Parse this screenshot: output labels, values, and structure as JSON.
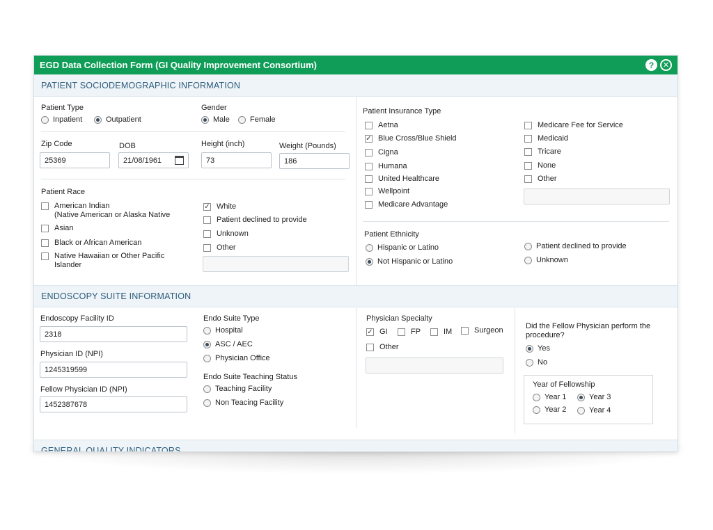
{
  "window": {
    "title": "EGD Data Collection Form (GI Quality Improvement Consortium)",
    "help_glyph": "?",
    "close_glyph": "✕"
  },
  "sections": {
    "patient": "PATIENT SOCIODEMOGRAPHIC INFORMATION",
    "endoscopy": "ENDOSCOPY SUITE INFORMATION",
    "quality": "GENERAL QUALITY INDICATORS"
  },
  "patient_type": {
    "label": "Patient Type",
    "options": [
      "Inpatient",
      "Outpatient"
    ],
    "selected": "Outpatient"
  },
  "gender": {
    "label": "Gender",
    "options": [
      "Male",
      "Female"
    ],
    "selected": "Male"
  },
  "zip": {
    "label": "Zip Code",
    "value": "25369"
  },
  "dob": {
    "label": "DOB",
    "value": "21/08/1961"
  },
  "height": {
    "label": "Height (inch)",
    "value": "73"
  },
  "weight": {
    "label": "Weight (Pounds)",
    "value": "186"
  },
  "race": {
    "label": "Patient Race",
    "american_indian": "American Indian",
    "american_indian_sub": "(Native American or Alaska Native",
    "asian": "Asian",
    "black": "Black or African American",
    "hawaiian_1": "Native Hawaiian or Other Pacific",
    "hawaiian_2": "Islander",
    "white": "White",
    "declined": "Patient declined to provide",
    "unknown": "Unknown",
    "other": "Other",
    "checked": [
      "White"
    ]
  },
  "insurance": {
    "label": "Patient Insurance Type",
    "col1": [
      "Aetna",
      "Blue Cross/Blue Shield",
      "Cigna",
      "Humana",
      "United Healthcare",
      "Wellpoint",
      "Medicare Advantage"
    ],
    "col2": [
      "Medicare Fee for Service",
      "Medicaid",
      "Tricare",
      "None",
      "Other"
    ],
    "checked": [
      "Blue Cross/Blue Shield"
    ]
  },
  "ethnicity": {
    "label": "Patient Ethnicity",
    "hispanic": "Hispanic or Latino",
    "not_hispanic": "Not Hispanic or Latino",
    "declined": "Patient declined to provide",
    "unknown": "Unknown",
    "selected": "Not Hispanic or Latino"
  },
  "facility_id": {
    "label": "Endoscopy Facility ID",
    "value": "2318"
  },
  "physician_id": {
    "label": "Physician ID (NPI)",
    "value": "1245319599"
  },
  "fellow_id": {
    "label": "Fellow Physician ID (NPI)",
    "value": "1452387678"
  },
  "suite_type": {
    "label": "Endo Suite Type",
    "options": [
      "Hospital",
      "ASC / AEC",
      "Physician Office"
    ],
    "selected": "ASC / AEC"
  },
  "teaching": {
    "label": "Endo Suite Teaching Status",
    "options": [
      "Teaching Facility",
      "Non Teacing Facility"
    ]
  },
  "specialty": {
    "label": "Physician Specialty",
    "gi": "GI",
    "fp": "FP",
    "im": "IM",
    "surgeon": "Surgeon",
    "other": "Other",
    "checked": [
      "GI"
    ]
  },
  "fellow_q": {
    "line1": "Did the Fellow Physician perform the",
    "line2": "procedure?",
    "yes": "Yes",
    "no": "No",
    "selected": "Yes"
  },
  "fellowship": {
    "label": "Year of Fellowship",
    "y1": "Year 1",
    "y2": "Year 2",
    "y3": "Year 3",
    "y4": "Year 4",
    "selected": "Year 3"
  }
}
